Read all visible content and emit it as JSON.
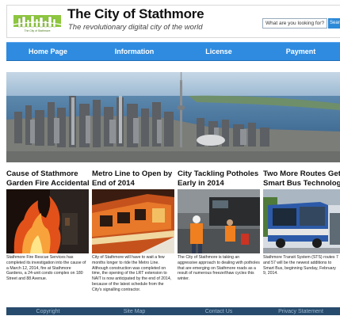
{
  "header": {
    "title": "The City of Stathmore",
    "tagline": "The revolutionary digital city of the world",
    "logo_caption": "The City of Stathmore",
    "search_placeholder": "What are you looking for?",
    "search_button": "Search"
  },
  "nav": {
    "items": [
      {
        "label": "Home Page"
      },
      {
        "label": "Information"
      },
      {
        "label": "License"
      },
      {
        "label": "Payment"
      }
    ]
  },
  "articles": [
    {
      "title_line1": "Cause of Stathmore",
      "title_line2": "Garden Fire Accidental",
      "text": "Stathmore Fire Rescue Services has completed its investigation into the cause of a March 12, 2014, fire at Stathmore Gardens, a 24-unit condo complex on 180 Street and 88 Avenue."
    },
    {
      "title_line1": "Metro Line to Open by",
      "title_line2": "End of 2014",
      "text": "City of Stathmore will have to wait a few months longer to ride the Metro Line. Although construction was completed on time, the opening of the LRT extension to NAIT is now anticipated by the end of 2014, because of the latest schedule from the City's signalling contractor."
    },
    {
      "title_line1": "City Tackling Potholes",
      "title_line2": "Early in 2014",
      "text": "The City of Stathmore is taking an aggressive approach to dealing with potholes that are emerging on Stathmore roads as a result of numerous freeze/thaw cycles this winter."
    },
    {
      "title_line1": "Two More Routes Get",
      "title_line2": "Smart Bus Technology",
      "text": "Stathmore Transit System (STS) routes 7 and 57 will be the newest additions to Smart Bus, beginning Sunday, February 9, 2014."
    }
  ],
  "footer": {
    "links": [
      {
        "label": "Copyright"
      },
      {
        "label": "Site Map"
      },
      {
        "label": "Contact Us"
      },
      {
        "label": "Privacy Statement"
      }
    ]
  },
  "colors": {
    "nav_blue": "#2e8be0",
    "footer_navy": "#274b6c",
    "logo_green": "#8dc63f"
  },
  "icons": {
    "logo": "city-skyline-logo"
  }
}
